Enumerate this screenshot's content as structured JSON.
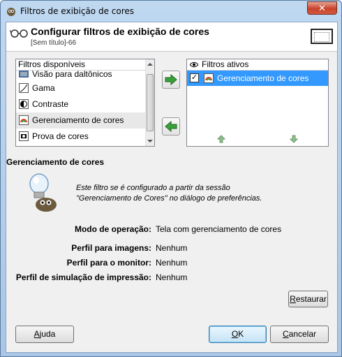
{
  "window": {
    "title": "Filtros de exibição de cores",
    "close_symbol": "✕",
    "icon": "gimp-icon"
  },
  "header": {
    "title": "Configurar filtros de exibição de cores",
    "subtitle": "[Sem título]-66",
    "left_icon": "glasses-icon",
    "right_icon": "image-preview-icon"
  },
  "available": {
    "column_label": "Filtros disponíveis",
    "items": [
      {
        "label": "Visão para daltônicos",
        "icon": "color-deficient-vision-icon"
      },
      {
        "label": "Gama",
        "icon": "gamma-icon"
      },
      {
        "label": "Contraste",
        "icon": "contrast-icon"
      },
      {
        "label": "Gerenciamento de cores",
        "icon": "color-management-icon"
      },
      {
        "label": "Prova de cores",
        "icon": "proof-colors-icon"
      }
    ]
  },
  "active": {
    "column_label": "Filtros ativos",
    "column_icon": "eye-icon",
    "items": [
      {
        "label": "Gerenciamento de cores",
        "checked": true,
        "check_symbol": "✓",
        "icon": "color-management-icon"
      }
    ]
  },
  "filter_detail": {
    "title": "Gerenciamento de cores",
    "icon": "wilber-lightbulb-icon",
    "description_line1": "Este filtro se é configurado a partir da sessão",
    "description_line2": "\"Gerenciamento de Cores\" no diálogo de preferências.",
    "fields": [
      {
        "label": "Modo de operação:",
        "value": "Tela com gerenciamento de cores"
      },
      {
        "label": "Perfil para imagens:",
        "value": "Nenhum"
      },
      {
        "label": "Perfil para o monitor:",
        "value": "Nenhum"
      },
      {
        "label": "Perfil de simulação de impressão:",
        "value": "Nenhum"
      }
    ]
  },
  "buttons": {
    "restore": {
      "first": "R",
      "rest": "estaurar"
    },
    "help": {
      "first": "A",
      "rest": "juda"
    },
    "ok": {
      "first": "O",
      "rest": "K"
    },
    "cancel": {
      "first": "C",
      "rest": "ancelar"
    }
  },
  "colors": {
    "selection": "#3399ff",
    "arrow_green": "#3aa03a",
    "title_bar": "#bfd8f0"
  }
}
